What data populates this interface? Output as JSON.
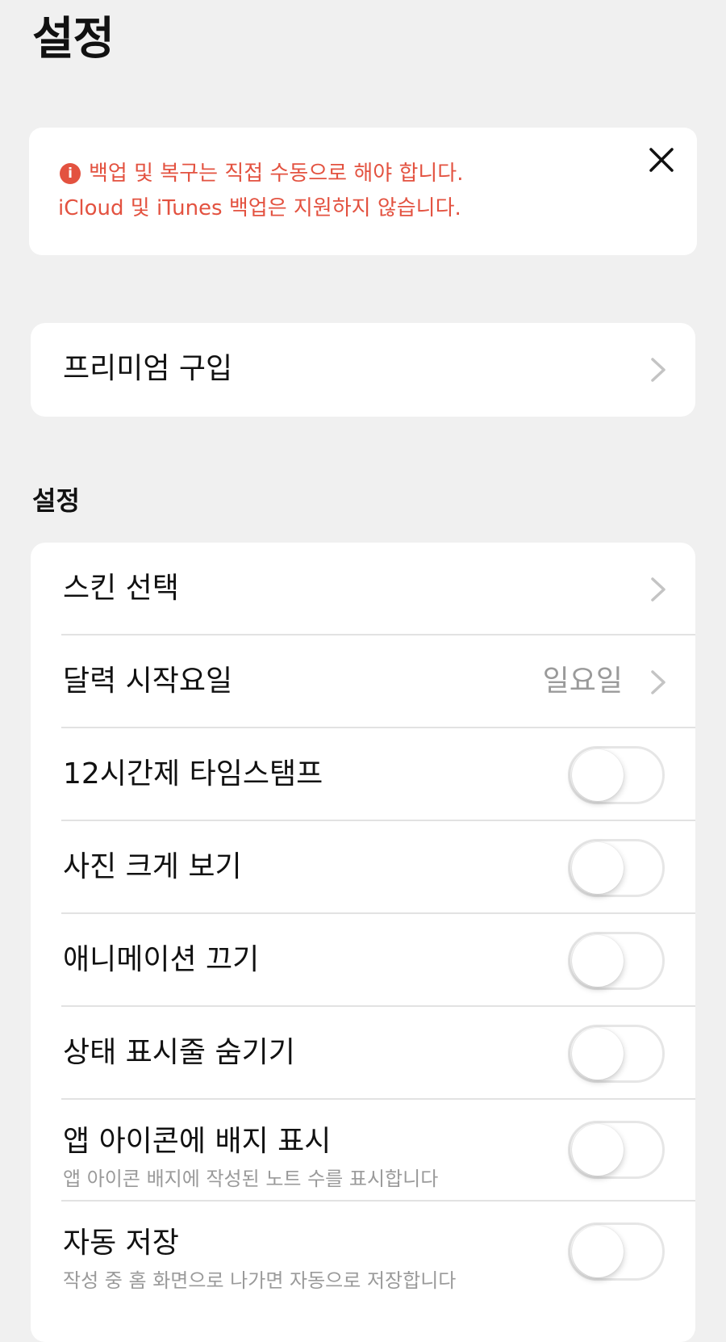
{
  "page": {
    "title": "설정"
  },
  "alert": {
    "line1": "백업 및 복구는 직접 수동으로 해야 합니다.",
    "line2": "iCloud 및 iTunes 백업은 지원하지 않습니다.",
    "info_icon_glyph": "i",
    "color": "#e35240"
  },
  "premium": {
    "label": "프리미엄 구입"
  },
  "settings": {
    "header": "설정",
    "skin": {
      "label": "스킨 선택"
    },
    "week_start": {
      "label": "달력 시작요일",
      "value": "일요일"
    },
    "timestamp_12h": {
      "label": "12시간제 타임스탬프",
      "enabled": false
    },
    "large_photos": {
      "label": "사진 크게 보기",
      "enabled": false
    },
    "disable_animation": {
      "label": "애니메이션 끄기",
      "enabled": false
    },
    "hide_status_bar": {
      "label": "상태 표시줄 숨기기",
      "enabled": false
    },
    "app_badge": {
      "label": "앱 아이콘에 배지 표시",
      "description": "앱 아이콘 배지에 작성된 노트 수를 표시합니다",
      "enabled": false
    },
    "auto_save": {
      "label": "자동 저장",
      "description": "작성 중 홈 화면으로 나가면 자동으로 저장합니다",
      "enabled": false
    }
  }
}
